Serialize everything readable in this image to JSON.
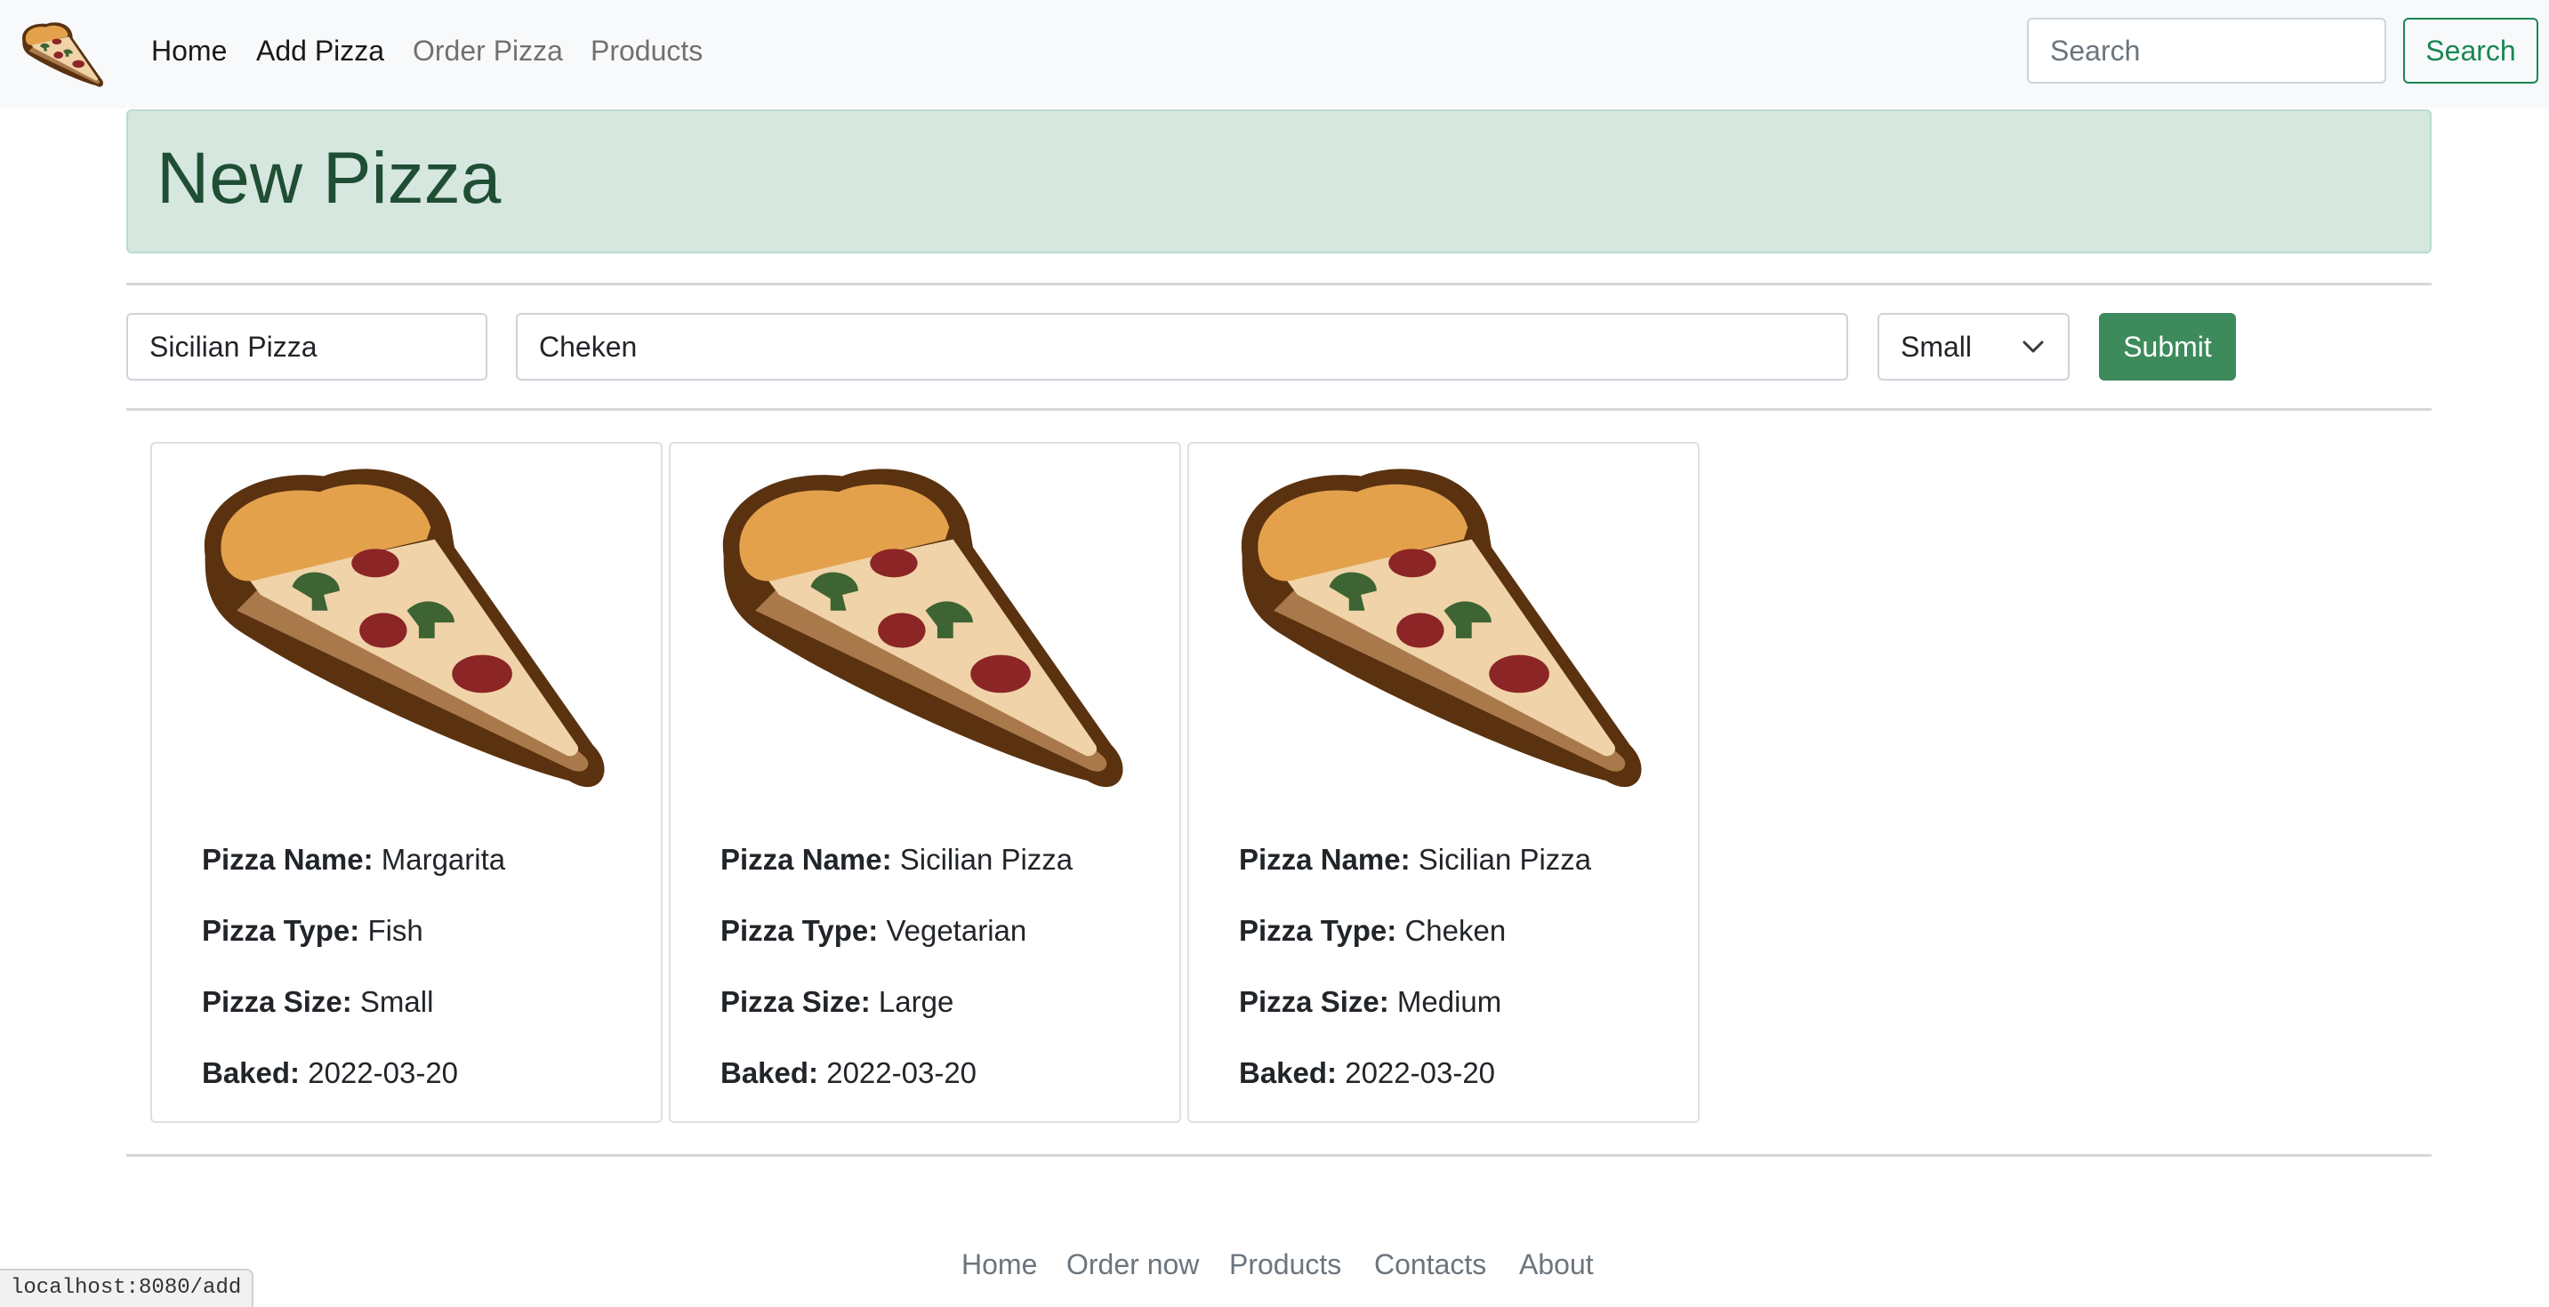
{
  "navbar": {
    "links": [
      {
        "label": "Home",
        "active": true
      },
      {
        "label": "Add Pizza",
        "active": true
      },
      {
        "label": "Order Pizza",
        "active": false
      },
      {
        "label": "Products",
        "active": false
      }
    ],
    "search": {
      "placeholder": "Search",
      "button_label": "Search"
    }
  },
  "header": {
    "title": "New Pizza"
  },
  "form": {
    "name_value": "Sicilian Pizza",
    "type_value": "Cheken",
    "size_selected": "Small",
    "submit_label": "Submit"
  },
  "cards": [
    {
      "name": "Margarita",
      "type": "Fish",
      "size": "Small",
      "baked": "2022-03-20"
    },
    {
      "name": "Sicilian Pizza",
      "type": "Vegetarian",
      "size": "Large",
      "baked": "2022-03-20"
    },
    {
      "name": "Sicilian Pizza",
      "type": "Cheken",
      "size": "Medium",
      "baked": "2022-03-20"
    }
  ],
  "card_labels": {
    "name": "Pizza Name:",
    "type": "Pizza Type:",
    "size": "Pizza Size:",
    "baked": "Baked:"
  },
  "footer": {
    "links": [
      "Home",
      "Order now",
      "Products",
      "Contacts",
      "About"
    ]
  },
  "status_bar": {
    "url": "localhost:8080/add"
  },
  "colors": {
    "success": "#198754",
    "alert_bg": "#d5e7df",
    "alert_text": "#1f4e34",
    "submit_bg": "#3d8a5c"
  },
  "icons": {
    "brand": "pizza-slice-icon",
    "card_image": "pizza-slice-icon",
    "select": "chevron-down-icon"
  }
}
